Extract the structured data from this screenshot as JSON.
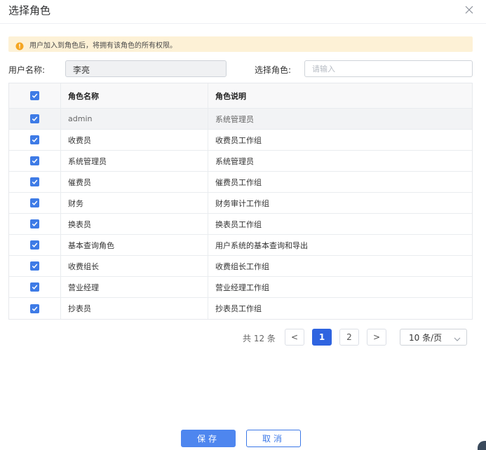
{
  "dialog": {
    "title": "选择角色"
  },
  "notice": {
    "text": "用户加入到角色后，将拥有该角色的所有权限。"
  },
  "form": {
    "username_label": "用户名称:",
    "username_value": "李亮",
    "role_label": "选择角色:",
    "role_placeholder": "请输入"
  },
  "table": {
    "headers": [
      "角色名称",
      "角色说明"
    ],
    "rows": [
      {
        "name": "admin",
        "desc": "系统管理员",
        "checked": true
      },
      {
        "name": "收费员",
        "desc": "收费员工作组",
        "checked": true
      },
      {
        "name": "系统管理员",
        "desc": "系统管理员",
        "checked": true
      },
      {
        "name": "催费员",
        "desc": "催费员工作组",
        "checked": true
      },
      {
        "name": "财务",
        "desc": "财务审计工作组",
        "checked": true
      },
      {
        "name": "换表员",
        "desc": "换表员工作组",
        "checked": true
      },
      {
        "name": "基本查询角色",
        "desc": "用户系统的基本查询和导出",
        "checked": true
      },
      {
        "name": "收费组长",
        "desc": "收费组长工作组",
        "checked": true
      },
      {
        "name": "营业经理",
        "desc": "营业经理工作组",
        "checked": true
      },
      {
        "name": "抄表员",
        "desc": "抄表员工作组",
        "checked": true
      }
    ]
  },
  "pagination": {
    "total_text": "共 12 条",
    "pages": [
      "1",
      "2"
    ],
    "current": "1",
    "page_size": "10 条/页",
    "prev": "<",
    "next": ">"
  },
  "footer": {
    "save_label": "保存",
    "cancel_label": "取消"
  },
  "colors": {
    "primary": "#2f64e0",
    "checkbox": "#3e7be6",
    "notice_bg": "#fdf1d6",
    "notice_icon": "#f5a623"
  }
}
